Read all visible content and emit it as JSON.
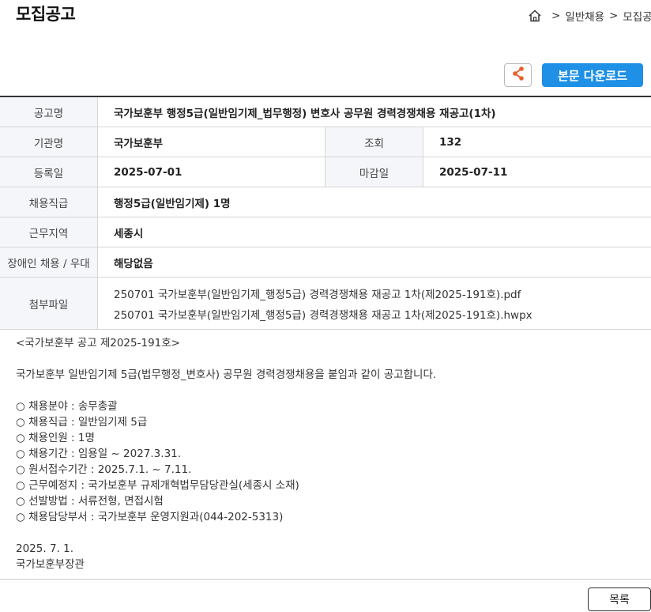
{
  "page": {
    "title": "모집공고"
  },
  "breadcrumb": {
    "home_icon": "home-icon",
    "separator": ">",
    "items": [
      "일반채용",
      "모집공고"
    ]
  },
  "actions": {
    "share_icon": "share-icon",
    "download_label": "본문 다운로드",
    "accent_color": "#1e90e6"
  },
  "info": {
    "title_label": "공고명",
    "title_value": "국가보훈부 행정5급(일반임기제_법무행정) 변호사 공무원 경력경쟁채용 재공고(1차)",
    "agency_label": "기관명",
    "agency_value": "국가보훈부",
    "views_label": "조회",
    "views_value": "132",
    "registered_label": "등록일",
    "registered_value": "2025-07-01",
    "deadline_label": "마감일",
    "deadline_value": "2025-07-11",
    "grade_label": "채용직급",
    "grade_value": "행정5급(일반임기제) 1명",
    "location_label": "근무지역",
    "location_value": "세종시",
    "disability_label": "장애인 채용 / 우대",
    "disability_value": "해당없음",
    "files_label": "첨부파일",
    "files": [
      "250701 국가보훈부(일반임기제_행정5급) 경력경쟁채용 재공고 1차(제2025-191호).pdf",
      "250701 국가보훈부(일반임기제_행정5급) 경력경쟁채용 재공고 1차(제2025-191호).hwpx"
    ]
  },
  "body": {
    "notice_no": "<국가보훈부 공고 제2025-191호>",
    "intro": "국가보훈부 일반임기제 5급(법무행정_변호사) 공무원 경력경쟁채용을 붙임과 같이 공고합니다.",
    "items": [
      "○ 채용분야 : 송무총괄",
      "○ 채용직급 : 일반임기제 5급",
      "○ 채용인원 : 1명",
      "○ 채용기간 : 임용일 ~ 2027.3.31.",
      "○ 원서접수기간 : 2025.7.1. ~ 7.11.",
      "○ 근무예정지 : 국가보훈부 규제개혁법무담당관실(세종시 소재)",
      "○ 선발방법 : 서류전형, 면접시험",
      "○ 채용담당부서 : 국가보훈부 운영지원과(044-202-5313)"
    ],
    "date": "2025. 7. 1.",
    "signer": "국가보훈부장관"
  },
  "footer": {
    "list_label": "목록"
  }
}
